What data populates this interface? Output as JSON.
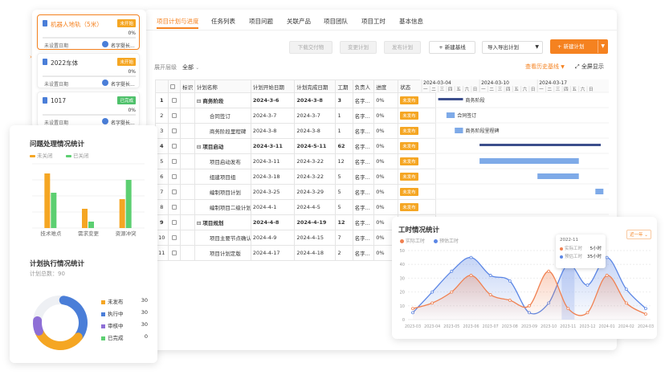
{
  "projects": [
    {
      "name": "机器人地轨（5米）",
      "status": "未开始",
      "status_color": "#f5a623",
      "percent": "0%",
      "date": "未设置日期",
      "owner": "名字挺长...",
      "selected": true
    },
    {
      "name": "2022车体",
      "status": "未开始",
      "status_color": "#f5a623",
      "percent": "0%",
      "date": "未设置日期",
      "owner": "名字挺长...",
      "selected": false
    },
    {
      "name": "1017",
      "status": "已完成",
      "status_color": "#4fc16b",
      "percent": "0%",
      "date": "未设置日期",
      "owner": "名字挺长...",
      "selected": false
    }
  ],
  "tabs": [
    "项目计划与进度",
    "任务列表",
    "项目问题",
    "关联产品",
    "项目团队",
    "项目工时",
    "基本信息"
  ],
  "toolbar": {
    "download": "下载交付物",
    "change": "变更计划",
    "publish": "发布计划",
    "new_baseline": "+  新建基线",
    "import_export": "导入导出计划",
    "new_plan": "+  新建计划",
    "expand_label": "展开层级",
    "expand_value": "全部",
    "history": "查看历史基线",
    "fullscreen": "全屏显示"
  },
  "table": {
    "headers": [
      "",
      "",
      "标识",
      "计划名称",
      "计划开始日期",
      "计划完成日期",
      "工期",
      "负责人",
      "进度",
      "状态"
    ],
    "rows": [
      {
        "no": "1",
        "name": "商务阶段",
        "start": "2024-3-6",
        "end": "2024-3-8",
        "dur": "3",
        "owner": "名字...",
        "progress": "0%",
        "status": "未发布",
        "bold": true,
        "indent": 0
      },
      {
        "no": "2",
        "name": "合同签订",
        "start": "2024-3-7",
        "end": "2024-3-7",
        "dur": "1",
        "owner": "名字...",
        "progress": "0%",
        "status": "未发布",
        "bold": false,
        "indent": 1
      },
      {
        "no": "3",
        "name": "商务阶段里程碑",
        "start": "2024-3-8",
        "end": "2024-3-8",
        "dur": "1",
        "owner": "名字...",
        "progress": "0%",
        "status": "未发布",
        "bold": false,
        "indent": 1
      },
      {
        "no": "4",
        "name": "项目启动",
        "start": "2024-3-11",
        "end": "2024-5-11",
        "dur": "62",
        "owner": "名字...",
        "progress": "0%",
        "status": "未发布",
        "bold": true,
        "indent": 0
      },
      {
        "no": "5",
        "name": "项目启动发布",
        "start": "2024-3-11",
        "end": "2024-3-22",
        "dur": "12",
        "owner": "名字...",
        "progress": "0%",
        "status": "未发布",
        "bold": false,
        "indent": 1
      },
      {
        "no": "6",
        "name": "组建项目组",
        "start": "2024-3-18",
        "end": "2024-3-22",
        "dur": "5",
        "owner": "名字...",
        "progress": "0%",
        "status": "未发布",
        "bold": false,
        "indent": 1
      },
      {
        "no": "7",
        "name": "编制项目计划",
        "start": "2024-3-25",
        "end": "2024-3-29",
        "dur": "5",
        "owner": "名字...",
        "progress": "0%",
        "status": "未发布",
        "bold": false,
        "indent": 1
      },
      {
        "no": "8",
        "name": "编制项目二级计划",
        "start": "2024-4-1",
        "end": "2024-4-5",
        "dur": "5",
        "owner": "名字...",
        "progress": "0%",
        "status": "未发布",
        "bold": false,
        "indent": 1
      },
      {
        "no": "9",
        "name": "项目规划",
        "start": "2024-4-8",
        "end": "2024-4-19",
        "dur": "12",
        "owner": "名字...",
        "progress": "0%",
        "status": "未发布",
        "bold": true,
        "indent": 0
      },
      {
        "no": "10",
        "name": "项目主要节点确认",
        "start": "2024-4-9",
        "end": "2024-4-15",
        "dur": "7",
        "owner": "名字...",
        "progress": "0%",
        "status": "未发布",
        "bold": false,
        "indent": 1
      },
      {
        "no": "11",
        "name": "项目计划定版",
        "start": "2024-4-17",
        "end": "2024-4-18",
        "dur": "2",
        "owner": "名字...",
        "progress": "0%",
        "status": "未发布",
        "bold": false,
        "indent": 1
      }
    ]
  },
  "gantt": {
    "weeks": [
      "2024-03-04",
      "2024-03-10",
      "2024-03-17"
    ],
    "days": [
      "一",
      "二",
      "三",
      "四",
      "五",
      "六",
      "日",
      "一",
      "二",
      "三",
      "四",
      "五",
      "六",
      "日",
      "一",
      "二",
      "三",
      "四",
      "五",
      "六",
      "日"
    ],
    "labels": [
      "商务阶段",
      "合同签订",
      "商务阶段里程碑"
    ]
  },
  "issue_chart": {
    "title": "问题处理情况统计",
    "legend": [
      "未关闭",
      "已关闭"
    ],
    "colors": [
      "#f5a623",
      "#5ccf71"
    ],
    "chart_data": {
      "type": "bar",
      "categories": [
        "技术难点",
        "需求变更",
        "资源冲突"
      ],
      "series": [
        {
          "name": "未关闭",
          "values": [
            17,
            6,
            9
          ]
        },
        {
          "name": "已关闭",
          "values": [
            11,
            2,
            15
          ]
        }
      ],
      "ylim": [
        0,
        20
      ]
    }
  },
  "plan_chart": {
    "title": "计划执行情况统计",
    "total": "计划总数：90",
    "chart_data": {
      "type": "pie",
      "labels": [
        "未发布",
        "执行中",
        "审核中",
        "已完成"
      ],
      "values": [
        30,
        30,
        30,
        0
      ],
      "colors": [
        "#f5a623",
        "#4a7ed8",
        "#8e6fd6",
        "#5ccf71"
      ]
    }
  },
  "hours_chart": {
    "title": "工时情况统计",
    "legend": [
      "实际工时",
      "预估工时"
    ],
    "colors": [
      "#f08050",
      "#5b86e5"
    ],
    "filter": "近一年",
    "tooltip": {
      "month": "2022-11",
      "actual": "5小时",
      "estimate": "35小时"
    },
    "chart_data": {
      "type": "line",
      "x": [
        "2023-03",
        "2023-04",
        "2023-05",
        "2023-06",
        "2023-07",
        "2023-08",
        "2023-09",
        "2023-10",
        "2023-11",
        "2023-12",
        "2024-01",
        "2024-02",
        "2024-03"
      ],
      "series": [
        {
          "name": "实际工时",
          "values": [
            8,
            12,
            20,
            32,
            18,
            14,
            10,
            35,
            8,
            5,
            32,
            12,
            4
          ]
        },
        {
          "name": "预估工时",
          "values": [
            5,
            20,
            35,
            45,
            32,
            28,
            5,
            12,
            40,
            25,
            45,
            22,
            8
          ]
        }
      ],
      "ylim": [
        0,
        50
      ],
      "yticks": [
        0,
        10,
        20,
        30,
        40,
        50
      ]
    }
  }
}
